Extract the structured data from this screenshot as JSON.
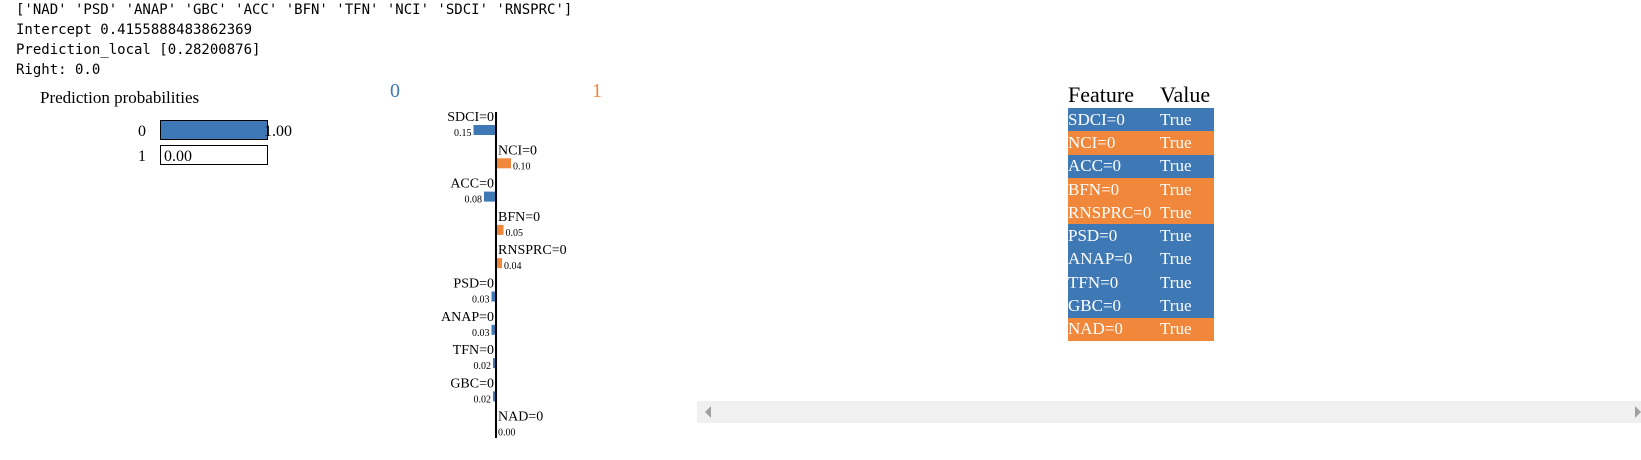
{
  "output": {
    "features_line": "['NAD' 'PSD' 'ANAP' 'GBC' 'ACC' 'BFN' 'TFN' 'NCI' 'SDCI' 'RNSPRC']",
    "intercept_line": "Intercept 0.4155888483862369",
    "prediction_line": "Prediction_local [0.28200876]",
    "right_line": "Right: 0.0"
  },
  "prediction_probabilities": {
    "title": "Prediction probabilities",
    "rows": [
      {
        "class": "0",
        "value": 1.0,
        "label": "1.00"
      },
      {
        "class": "1",
        "value": 0.0,
        "label": "0.00"
      }
    ]
  },
  "chart_data": {
    "type": "bar",
    "orientation": "horizontal",
    "class_labels": [
      "0",
      "1"
    ],
    "colors": {
      "class_0": "#3e79b6",
      "class_1": "#f0873a"
    },
    "items": [
      {
        "feature": "SDCI=0",
        "weight": -0.15,
        "label": "0.15"
      },
      {
        "feature": "NCI=0",
        "weight": 0.1,
        "label": "0.10"
      },
      {
        "feature": "ACC=0",
        "weight": -0.08,
        "label": "0.08"
      },
      {
        "feature": "BFN=0",
        "weight": 0.05,
        "label": "0.05"
      },
      {
        "feature": "RNSPRC=0",
        "weight": 0.04,
        "label": "0.04"
      },
      {
        "feature": "PSD=0",
        "weight": -0.03,
        "label": "0.03"
      },
      {
        "feature": "ANAP=0",
        "weight": -0.03,
        "label": "0.03"
      },
      {
        "feature": "TFN=0",
        "weight": -0.02,
        "label": "0.02"
      },
      {
        "feature": "GBC=0",
        "weight": -0.02,
        "label": "0.02"
      },
      {
        "feature": "NAD=0",
        "weight": 0.0,
        "label": "0.00"
      }
    ]
  },
  "feature_table": {
    "headers": [
      "Feature",
      "Value"
    ],
    "rows": [
      {
        "feature": "SDCI=0",
        "value": "True",
        "side": "0"
      },
      {
        "feature": "NCI=0",
        "value": "True",
        "side": "1"
      },
      {
        "feature": "ACC=0",
        "value": "True",
        "side": "0"
      },
      {
        "feature": "BFN=0",
        "value": "True",
        "side": "1"
      },
      {
        "feature": "RNSPRC=0",
        "value": "True",
        "side": "1"
      },
      {
        "feature": "PSD=0",
        "value": "True",
        "side": "0"
      },
      {
        "feature": "ANAP=0",
        "value": "True",
        "side": "0"
      },
      {
        "feature": "TFN=0",
        "value": "True",
        "side": "0"
      },
      {
        "feature": "GBC=0",
        "value": "True",
        "side": "0"
      },
      {
        "feature": "NAD=0",
        "value": "True",
        "side": "1"
      }
    ]
  }
}
